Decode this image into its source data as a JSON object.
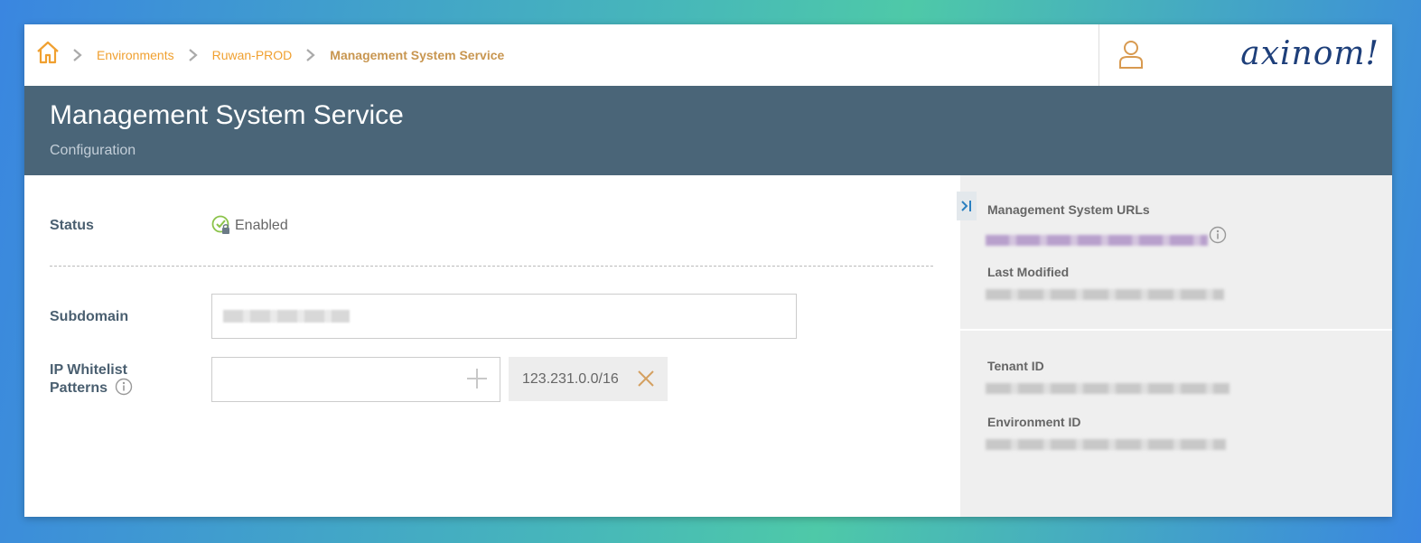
{
  "breadcrumb": {
    "items": [
      {
        "label": "Environments"
      },
      {
        "label": "Ruwan-PROD"
      },
      {
        "label": "Management System Service"
      }
    ]
  },
  "brand": {
    "logo_text": "axinom!"
  },
  "header": {
    "title": "Management System Service",
    "subtitle": "Configuration"
  },
  "form": {
    "status": {
      "label": "Status",
      "value": "Enabled"
    },
    "subdomain": {
      "label": "Subdomain"
    },
    "ip_whitelist": {
      "label_line1": "IP Whitelist",
      "label_line2": "Patterns",
      "patterns": [
        "123.231.0.0/16"
      ]
    }
  },
  "side_panel": {
    "urls_label": "Management System URLs",
    "last_modified_label": "Last Modified",
    "tenant_id_label": "Tenant ID",
    "environment_id_label": "Environment ID"
  },
  "colors": {
    "accent": "#f0a030",
    "header_bg": "#4a6578",
    "status_ok": "#8bc34a"
  },
  "icons": {
    "home": "home-icon",
    "user": "user-icon",
    "status": "check-circle-lock-icon",
    "add": "plus-icon",
    "remove": "close-icon",
    "info": "info-icon",
    "collapse": "collapse-panel-icon"
  }
}
